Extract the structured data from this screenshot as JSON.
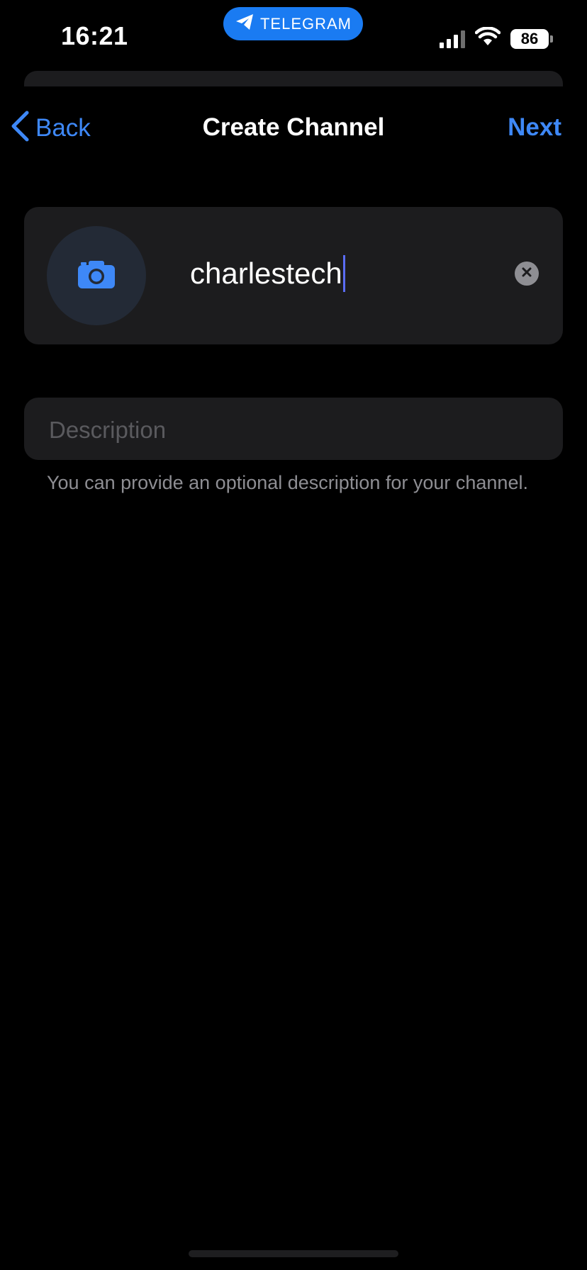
{
  "status_bar": {
    "time": "16:21",
    "pill_label": "TELEGRAM",
    "battery": "86"
  },
  "nav": {
    "back_label": "Back",
    "title": "Create Channel",
    "next_label": "Next"
  },
  "channel": {
    "name_value": "charlestech",
    "description_placeholder": "Description",
    "description_hint": "You can provide an optional description for your channel."
  },
  "colors": {
    "accent": "#3e88f7",
    "pill": "#1a7bf2",
    "card": "#1c1c1e",
    "caret": "#5a6cf5"
  },
  "icons": {
    "pill": "telegram-plane-icon",
    "back": "chevron-left-icon",
    "avatar": "camera-icon",
    "clear": "clear-x-icon"
  }
}
